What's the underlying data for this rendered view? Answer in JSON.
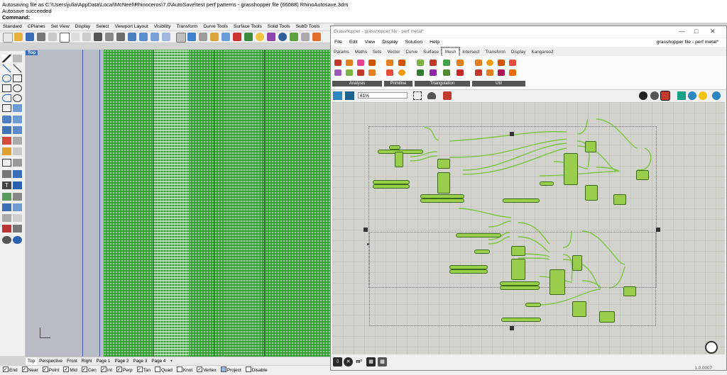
{
  "rhino": {
    "command_lines": [
      "Autosaving file as C:\\Users\\julia\\AppData\\Local\\McNeel\\Rhinoceros\\7.0\\AutoSave\\test perf patterns - grasshopper file (66688) RhinoAutosave.3dm",
      "Autosave succeeded",
      "Command:"
    ],
    "menu_tabs": [
      "Standard",
      "CPlanes",
      "Set View",
      "Display",
      "Select",
      "Viewport Layout",
      "Visibility",
      "Transform",
      "Curve Tools",
      "Surface Tools",
      "Solid Tools",
      "SubD Tools"
    ],
    "viewport": {
      "label": "Top"
    },
    "view_tabs": [
      "Top",
      "Perspective",
      "Front",
      "Right",
      "Page 1",
      "Page 2",
      "Page 3",
      "Page 4",
      "+"
    ],
    "osnaps": [
      {
        "label": "End",
        "checked": true
      },
      {
        "label": "Near",
        "checked": true
      },
      {
        "label": "Point",
        "checked": true
      },
      {
        "label": "Mid",
        "checked": true
      },
      {
        "label": "Cen",
        "checked": true
      },
      {
        "label": "Int",
        "checked": true
      },
      {
        "label": "Perp",
        "checked": true
      },
      {
        "label": "Tan",
        "checked": true
      },
      {
        "label": "Quad",
        "checked": false
      },
      {
        "label": "Knot",
        "checked": false
      },
      {
        "label": "Vertex",
        "checked": true
      },
      {
        "label": "Project",
        "checked": false
      },
      {
        "label": "Disable",
        "checked": false
      }
    ]
  },
  "grasshopper": {
    "title": "Grasshopper - grasshopper file - perf metal*",
    "menu": [
      "File",
      "Edit",
      "View",
      "Display",
      "Solution",
      "Help"
    ],
    "document_name": "grasshopper file - perf metal*",
    "tabs": [
      "Params",
      "Maths",
      "Sets",
      "Vector",
      "Curve",
      "Surface",
      "Mesh",
      "Intersect",
      "Transform",
      "Display",
      "Kangaroo2"
    ],
    "selected_tab": "Mesh",
    "ribbon_groups": [
      "Analysis",
      "Primitive",
      "Triangulation",
      "Util"
    ],
    "zoom": "61%",
    "version": "1.0.0007",
    "bottom_icons": [
      "m²"
    ]
  },
  "colors": {
    "accent": "#3d6fb5",
    "node_green": "#9acd4c",
    "node_dark": "#2e5f1a",
    "wire": "#7dc443",
    "pattern_green": "#3aa03a"
  }
}
